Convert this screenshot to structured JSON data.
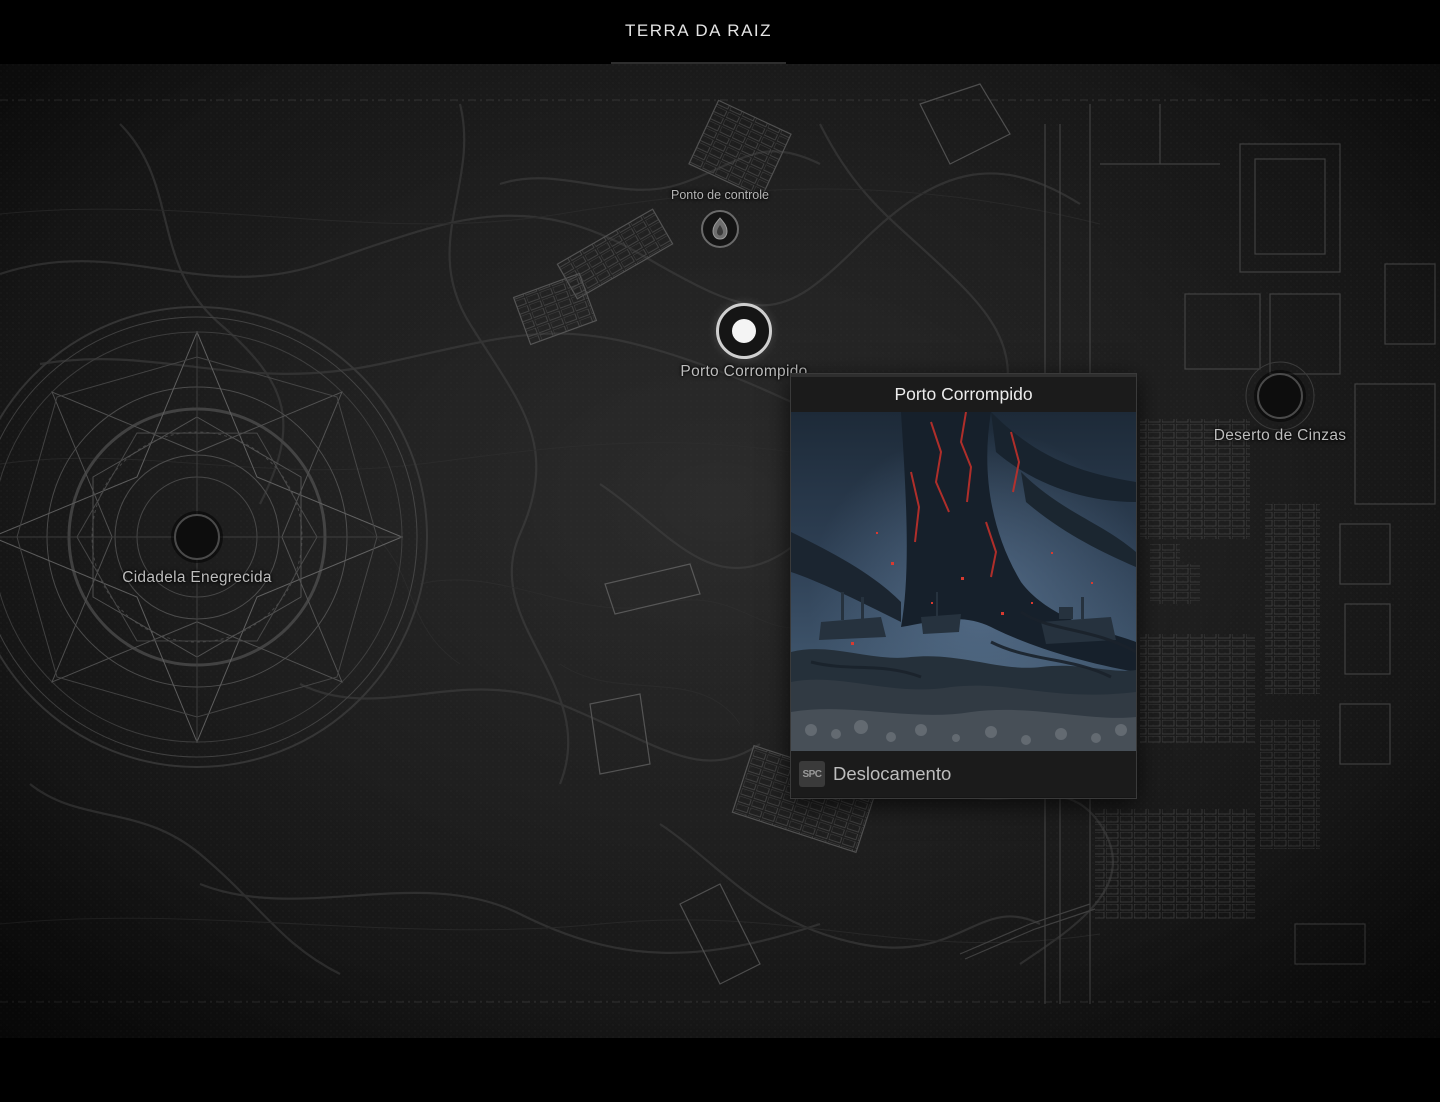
{
  "header": {
    "region_title": "TERRA DA RAIZ"
  },
  "map": {
    "locations": [
      {
        "id": "cidadela",
        "label": "Cidadela Enegrecida",
        "state": "unselected"
      },
      {
        "id": "porto",
        "label": "Porto Corrompido",
        "state": "selected"
      },
      {
        "id": "deserto",
        "label": "Deserto de Cinzas",
        "state": "unselected"
      }
    ],
    "checkpoint": {
      "label": "Ponto de controle",
      "icon": "checkpoint-icon"
    }
  },
  "card": {
    "title": "Porto Corrompido",
    "key": "SPC",
    "action": "Deslocamento",
    "image": "corrupted-harbor-scene"
  },
  "colors": {
    "background": "#000000",
    "map_base": "#222222",
    "marker_ring_active": "#cfcfcf",
    "ember_red": "#c0302a",
    "scene_blue": "#3b4f66"
  }
}
